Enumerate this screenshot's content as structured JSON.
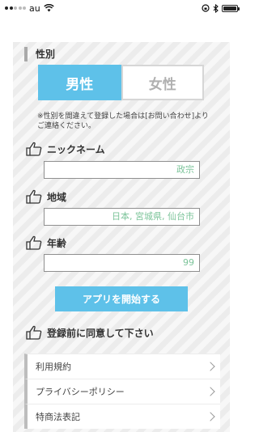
{
  "status_bar": {
    "carrier": "au"
  },
  "gender": {
    "section_label": "性別",
    "male_label": "男性",
    "female_label": "女性",
    "selected": "男性",
    "notice": "※性別を間違えて登録した場合は[お問い合わせ]よりご連絡ください。"
  },
  "nickname": {
    "label": "ニックネーム",
    "value": "政宗"
  },
  "region": {
    "label": "地域",
    "value": "日本, 宮城県, 仙台市"
  },
  "age": {
    "label": "年齢",
    "value": "99"
  },
  "start_button": "アプリを開始する",
  "agree_label": "登録前に同意して下さい",
  "links": [
    {
      "label": "利用規約"
    },
    {
      "label": "プライバシーポリシー"
    },
    {
      "label": "特商法表記"
    }
  ],
  "colors": {
    "accent": "#5ec1e9",
    "field_text": "#7cc49a"
  },
  "icons": {
    "label_icon": "thumbs-up-icon",
    "list_icon": "chevron-right-icon"
  }
}
